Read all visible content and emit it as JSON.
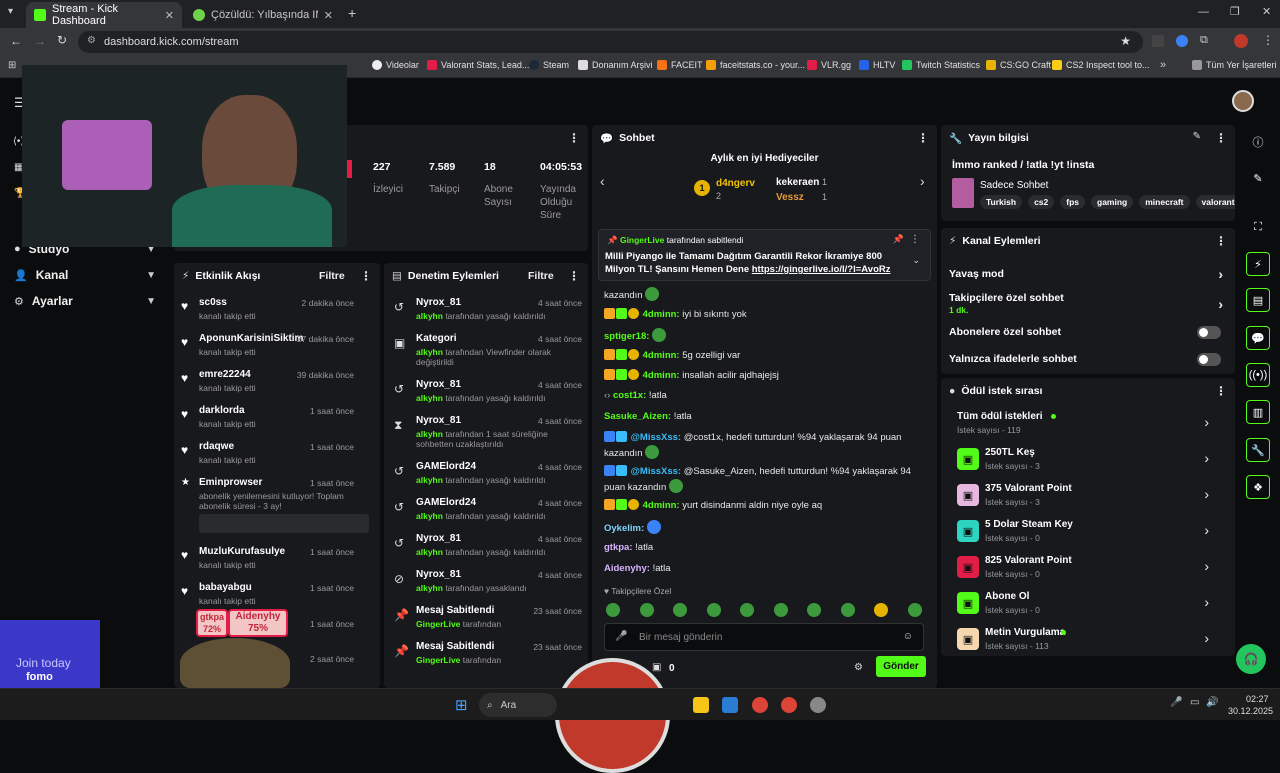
{
  "browser": {
    "tabs": [
      {
        "title": "Stream - Kick Dashboard",
        "active": true
      },
      {
        "title": "Çözüldü: Yılbaşında IMEI sıfırlar",
        "active": false
      }
    ],
    "url": "dashboard.kick.com/stream",
    "bookmarks": [
      "Videolar",
      "Valorant Stats, Lead...",
      "Steam",
      "Donanım Arşivi",
      "FACEIT",
      "faceitstats.co - your...",
      "VLR.gg",
      "HLTV",
      "Twitch Statistics",
      "CS:GO Craft",
      "CS2 Inspect tool to..."
    ],
    "all_bookmarks": "Tüm Yer İşaretleri",
    "colors": {
      "accent": "#53fc18",
      "chrome_bg": "#202124"
    }
  },
  "sidebar": {
    "items": [
      {
        "label": "Stüdyo"
      },
      {
        "label": "Kanal"
      },
      {
        "label": "Ayarlar"
      }
    ]
  },
  "stats": [
    {
      "value": "227",
      "label": "İzleyici"
    },
    {
      "value": "7.589",
      "label": "Takipçi"
    },
    {
      "value": "18",
      "label": "Abone Sayısı"
    },
    {
      "value": "04:05:53",
      "label": "Yayında Olduğu Süre"
    }
  ],
  "activity": {
    "title": "Etkinlik Akışı",
    "filter": "Filtre",
    "items": [
      {
        "name": "sc0ss",
        "sub": "kanalı takip etti",
        "time": "2 dakika önce"
      },
      {
        "name": "AponunKarisiniSiktim",
        "sub": "kanalı takip etti",
        "time": "27 dakika önce"
      },
      {
        "name": "emre22244",
        "sub": "kanalı takip etti",
        "time": "39 dakika önce"
      },
      {
        "name": "darklorda",
        "sub": "kanalı takip etti",
        "time": "1 saat önce"
      },
      {
        "name": "rdaqwe",
        "sub": "kanalı takip etti",
        "time": "1 saat önce"
      },
      {
        "name": "Eminprowser",
        "sub": "abonelik yenilemesini kutluyor! Toplam abonelik süresi - 3 ay!",
        "time": "1 saat önce"
      },
      {
        "name": "MuzluKurufasulye",
        "sub": "kanalı takip etti",
        "time": "1 saat önce"
      },
      {
        "name": "babayabgu",
        "sub": "kanalı takip etti",
        "time": "1 saat önce"
      },
      {
        "name": "",
        "sub": "",
        "time": "1 saat önce"
      },
      {
        "name": "",
        "sub": "",
        "time": "2 saat önce"
      }
    ]
  },
  "moderation": {
    "title": "Denetim Eylemleri",
    "filter": "Filtre",
    "items": [
      {
        "name": "Nyrox_81",
        "actor": "alkyhn",
        "sub": "tarafından yasağı kaldırıldı",
        "time": "4 saat önce"
      },
      {
        "name": "Kategori",
        "actor": "alkyhn",
        "sub": "tarafından Viewfinder olarak değiştirildi",
        "time": "4 saat önce"
      },
      {
        "name": "Nyrox_81",
        "actor": "alkyhn",
        "sub": "tarafından yasağı kaldırıldı",
        "time": "4 saat önce"
      },
      {
        "name": "Nyrox_81",
        "actor": "alkyhn",
        "sub": "tarafından 1 saat süreliğine sohbetten uzaklaştırıldı",
        "time": "4 saat önce"
      },
      {
        "name": "GAMElord24",
        "actor": "alkyhn",
        "sub": "tarafından yasağı kaldırıldı",
        "time": "4 saat önce"
      },
      {
        "name": "GAMElord24",
        "actor": "alkyhn",
        "sub": "tarafından yasağı kaldırıldı",
        "time": "4 saat önce"
      },
      {
        "name": "Nyrox_81",
        "actor": "alkyhn",
        "sub": "tarafından yasağı kaldırıldı",
        "time": "4 saat önce"
      },
      {
        "name": "Nyrox_81",
        "actor": "alkyhn",
        "sub": "tarafından yasaklandı",
        "time": "4 saat önce"
      },
      {
        "name": "Mesaj Sabitlendi",
        "actor": "GingerLive",
        "sub": "tarafından",
        "time": "23 saat önce"
      },
      {
        "name": "Mesaj Sabitlendi",
        "actor": "GingerLive",
        "sub": "tarafından",
        "time": "23 saat önce"
      }
    ]
  },
  "chat": {
    "title": "Sohbet",
    "gifters_title": "Aylık en iyi Hediyeciler",
    "gifters": [
      {
        "name": "d4ngerv",
        "count": "2"
      },
      {
        "name": "kekeraen",
        "count": "1"
      },
      {
        "name": "Vessz",
        "count": "1"
      }
    ],
    "pinned": {
      "by": "GingerLive",
      "by_suffix": "tarafından sabitlendi",
      "text": "Milli Piyango ile Tamamı Dağıtım Garantili Rekor İkramiye 800 Milyon TL! Şansını Hemen Dene",
      "link": "https://gingerlive.io/l/?l=AvoRz"
    },
    "messages": [
      {
        "user": "",
        "text": "kazandın"
      },
      {
        "user": "4dminn:",
        "text": "iyi bi sıkıntı yok"
      },
      {
        "user": "sptiger18:",
        "text": ""
      },
      {
        "user": "4dminn:",
        "text": "5g ozelligi var"
      },
      {
        "user": "4dminn:",
        "text": "insallah acilir ajdhajejsj"
      },
      {
        "user": "cost1x:",
        "text": "!atla"
      },
      {
        "user": "Sasuke_Aizen:",
        "text": "!atla"
      },
      {
        "user": "@MissXss:",
        "text": "@cost1x, hedefi tutturdun! %94 yaklaşarak 94 puan kazandın"
      },
      {
        "user": "@MissXss:",
        "text": "@Sasuke_Aizen, hedefi tutturdun! %94 yaklaşarak 94 puan kazandın"
      },
      {
        "user": "4dminn:",
        "text": "yurt disindanmi aldin niye oyle aq"
      },
      {
        "user": "Oykelim:",
        "text": ""
      },
      {
        "user": "gtkpa:",
        "text": "!atla"
      },
      {
        "user": "Aidenyhy:",
        "text": "!atla"
      }
    ],
    "followers_only": "Takipçilere Özel",
    "input_placeholder": "Bir mesaj gönderin",
    "points": "0",
    "send": "Gönder"
  },
  "stream_info": {
    "title": "Yayın bilgisi",
    "stream_title": "İmmo ranked / !atla !yt !insta",
    "category": "Sadece Sohbet",
    "tags": [
      "Turkish",
      "cs2",
      "fps",
      "gaming",
      "minecraft",
      "valorant"
    ]
  },
  "channel_actions": {
    "title": "Kanal Eylemleri",
    "slow": "Yavaş mod",
    "followers_chat": "Takipçilere özel sohbet",
    "followers_chat_sub": "1 dk.",
    "subs_chat": "Abonelere özel sohbet",
    "emotes_chat": "Yalnızca ifadelerle sohbet"
  },
  "rewards": {
    "title": "Ödül istek sırası",
    "items": [
      {
        "name": "Tüm ödül istekleri",
        "sub": "İstek sayısı - 119",
        "color": ""
      },
      {
        "name": "250TL Keş",
        "sub": "İstek sayısı - 3",
        "color": "#53fc18"
      },
      {
        "name": "375 Valorant Point",
        "sub": "İstek sayısı - 3",
        "color": "#e7b7e0"
      },
      {
        "name": "5 Dolar Steam Key",
        "sub": "İstek sayısı - 0",
        "color": "#2dd4bf"
      },
      {
        "name": "825 Valorant Point",
        "sub": "İstek sayısı - 0",
        "color": "#e11d48"
      },
      {
        "name": "Abone Ol",
        "sub": "İstek sayısı - 0",
        "color": "#53fc18"
      },
      {
        "name": "Metin Vurgulama",
        "sub": "İstek sayısı - 113",
        "color": "#f5d7b0"
      }
    ]
  },
  "overlay": {
    "join_text": "Join today",
    "brand": "fomo",
    "players": [
      {
        "name": "gtkpa",
        "pct": "72%"
      },
      {
        "name": "Aidenyhy",
        "pct": "75%"
      }
    ]
  },
  "taskbar": {
    "search": "Ara",
    "time": "02:27",
    "date": "30.12.2025"
  }
}
